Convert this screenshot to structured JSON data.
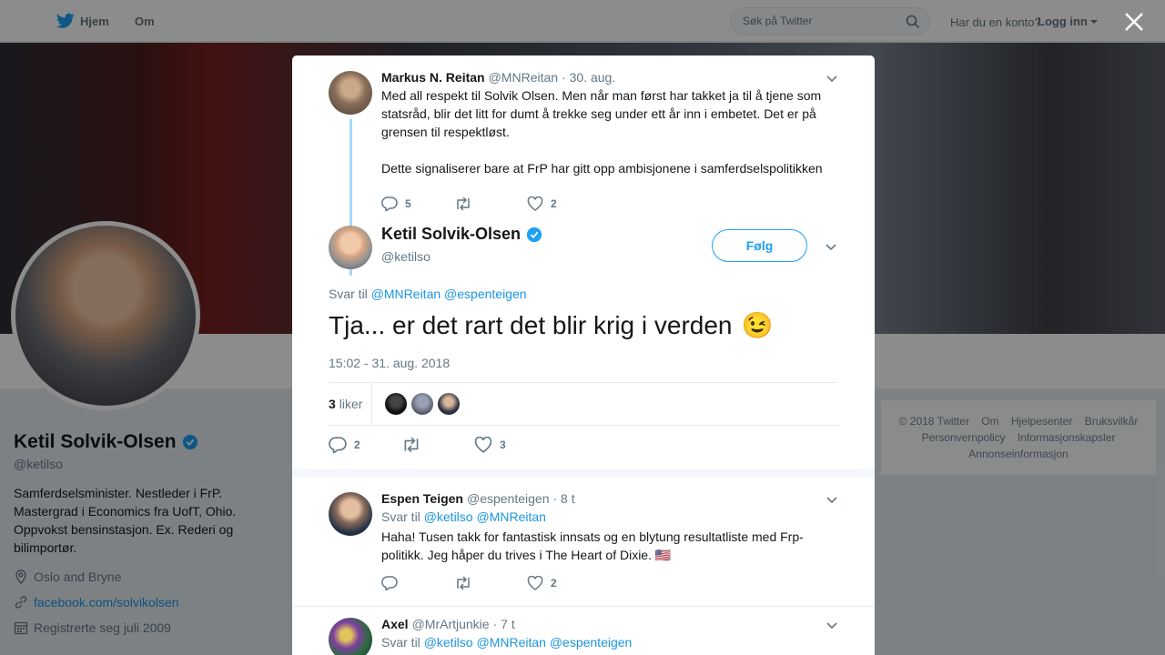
{
  "topnav": {
    "home_label": "Hjem",
    "about_label": "Om",
    "search_placeholder": "Søk på Twitter",
    "has_account": "Har du en konto?",
    "login_label": "Logg inn"
  },
  "profile": {
    "name": "Ketil Solvik-Olsen",
    "handle": "@ketilso",
    "bio": "Samferdselsminister. Nestleder i FrP. Mastergrad i Economics fra UofT, Ohio. Oppvokst bensinstasjon. Ex. Rederi og bilimportør.",
    "location": "Oslo and Bryne",
    "website": "facebook.com/solvikolsen",
    "joined": "Registrerte seg juli 2009"
  },
  "footer": {
    "links": [
      "© 2018 Twitter",
      "Om",
      "Hjelpesenter",
      "Bruksvilkår",
      "Personvernpolicy",
      "Informasjonskapsler",
      "Annonseinformasjon"
    ]
  },
  "parent_tweet": {
    "name": "Markus N. Reitan",
    "handle": "@MNReitan",
    "date": "· 30. aug.",
    "text1": "Med all respekt til Solvik Olsen. Men når man først har takket ja til å tjene som statsråd, blir det litt for dumt å trekke seg under ett år inn i embetet. Det er på grensen til respektløst.",
    "text2": "Dette signaliserer bare at FrP har gitt opp ambisjonene i samferdselspolitikken",
    "replies": "5",
    "retweets": "",
    "likes": "2"
  },
  "main_tweet": {
    "name": "Ketil Solvik-Olsen",
    "handle": "@ketilso",
    "follow_label": "Følg",
    "reply_prefix": "Svar til",
    "reply_to_1": "@MNReitan",
    "reply_to_2": "@espenteigen",
    "text": "Tja... er det rart det blir krig i verden",
    "emoji": "😉",
    "timestamp": "15:02 - 31. aug. 2018",
    "likes_count": "3",
    "likes_word": "liker",
    "replies": "2",
    "retweets": "",
    "likes": "3"
  },
  "replies": [
    {
      "name": "Espen Teigen",
      "handle": "@espenteigen",
      "date": "· 8 t",
      "reply_prefix": "Svar til",
      "reply_to_1": "@ketilso",
      "reply_to_2": "@MNReitan",
      "text": "Haha! Tusen takk for fantastisk innsats og en blytung resultatliste med Frp-politikk. Jeg håper du trives i The Heart of Dixie.",
      "flag": "🇺🇸",
      "replies": "",
      "retweets": "",
      "likes": "2"
    },
    {
      "name": "Axel",
      "handle": "@MrArtjunkie",
      "date": "· 7 t",
      "reply_prefix": "Svar til",
      "reply_to_1": "@ketilso",
      "reply_to_2": "@MNReitan",
      "reply_to_3": "@espenteigen"
    }
  ],
  "colors": {
    "accent": "#1da1f2",
    "link": "#1b95e0",
    "muted": "#657786",
    "thread_line": "#a4d9f9",
    "verified": "#1da1f2"
  }
}
